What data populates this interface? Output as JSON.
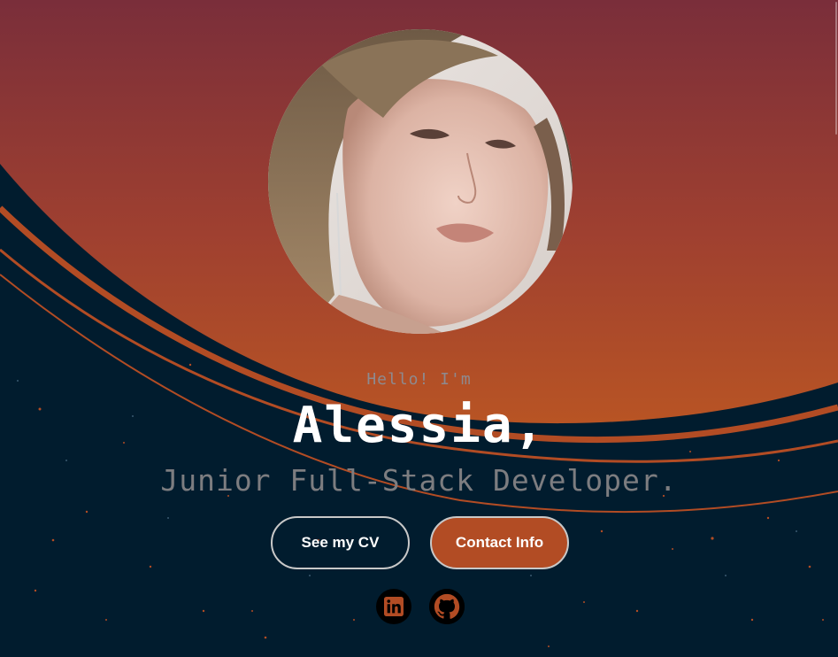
{
  "hero": {
    "greeting": "Hello! I'm",
    "name": "Alessia,",
    "role": "Junior Full-Stack Developer."
  },
  "buttons": {
    "cv_label": "See my CV",
    "contact_label": "Contact Info"
  },
  "social": {
    "linkedin_icon": "linkedin-icon",
    "github_icon": "github-icon"
  },
  "colors": {
    "background_dark": "#011c2e",
    "gradient_top": "#7a2e3a",
    "gradient_bottom": "#b24c24",
    "accent": "#b24c24",
    "text_primary": "#ffffff",
    "text_muted": "#8e8a8f"
  }
}
